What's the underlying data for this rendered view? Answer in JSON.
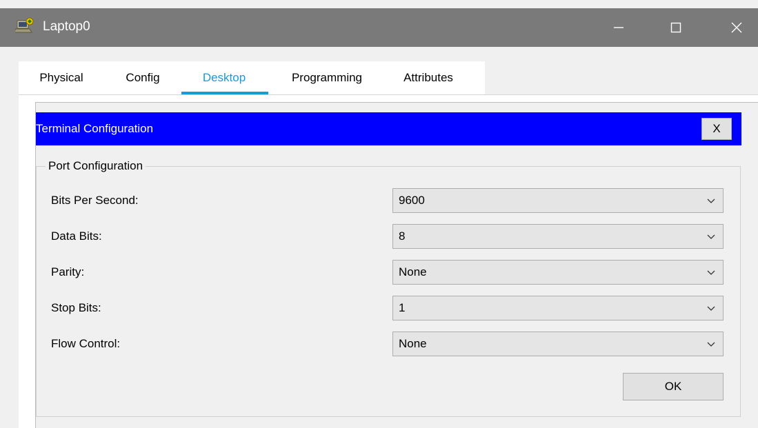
{
  "window": {
    "title": "Laptop0",
    "icon": "laptop-app-icon",
    "controls": [
      "minimize-icon",
      "maximize-icon",
      "close-icon"
    ]
  },
  "tabs": [
    {
      "label": "Physical",
      "active": false
    },
    {
      "label": "Config",
      "active": false
    },
    {
      "label": "Desktop",
      "active": true
    },
    {
      "label": "Programming",
      "active": false
    },
    {
      "label": "Attributes",
      "active": false
    }
  ],
  "dialog": {
    "title": "Terminal Configuration",
    "close_label": "X",
    "group_label": "Port Configuration",
    "fields": [
      {
        "label": "Bits Per Second:",
        "value": "9600"
      },
      {
        "label": "Data Bits:",
        "value": "8"
      },
      {
        "label": "Parity:",
        "value": "None"
      },
      {
        "label": "Stop Bits:",
        "value": "1"
      },
      {
        "label": "Flow Control:",
        "value": "None"
      }
    ],
    "ok_label": "OK"
  },
  "colors": {
    "header_bg": "#0000ff",
    "active_tab": "#1a9ad6",
    "titlebar_bg": "#7a7a7a"
  }
}
